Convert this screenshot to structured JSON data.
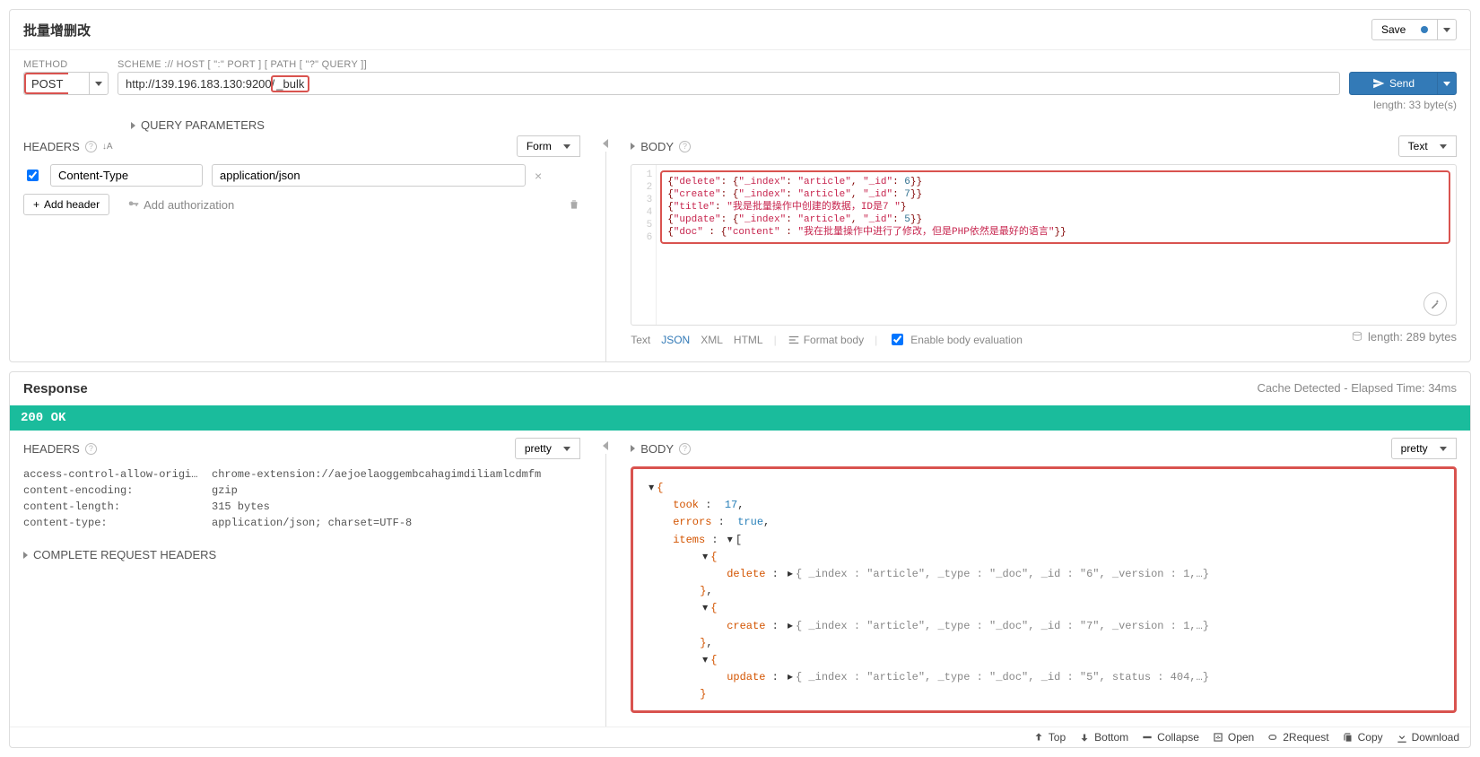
{
  "request": {
    "title": "批量增删改",
    "save_label": "Save",
    "method_label": "METHOD",
    "scheme_label": "SCHEME :// HOST [ \":\" PORT ] [ PATH [ \"?\" QUERY ]]",
    "method": "POST",
    "url_prefix": "http://139.196.183.130:9200/",
    "url_highlight": "_bulk",
    "send_label": "Send",
    "length_note": "length: 33 byte(s)",
    "query_params_label": "QUERY PARAMETERS",
    "headers_label": "HEADERS",
    "form_label": "Form",
    "header_name": "Content-Type",
    "header_value": "application/json",
    "add_header_label": "Add header",
    "add_auth_label": "Add authorization",
    "body_label": "BODY",
    "text_label": "Text",
    "body_lines": [
      "{\"delete\": {\"_index\": \"article\", \"_id\": 6}}",
      "{\"create\": {\"_index\": \"article\", \"_id\": 7}}",
      "{\"title\": \"我是批量操作中创建的数据，ID是7 \"}",
      "{\"update\": {\"_index\": \"article\", \"_id\": 5}}",
      "{\"doc\" : {\"content\" : \"我在批量操作中进行了修改，但是PHP依然是最好的语言\"}}"
    ],
    "footer_tabs": {
      "text": "Text",
      "json": "JSON",
      "xml": "XML",
      "html": "HTML"
    },
    "format_body_label": "Format body",
    "enable_eval_label": "Enable body evaluation",
    "body_length_label": "length: 289 bytes"
  },
  "response": {
    "title": "Response",
    "meta": "Cache Detected - Elapsed Time: 34ms",
    "status": "200  OK",
    "headers_label": "HEADERS",
    "pretty_label": "pretty",
    "headers": [
      {
        "k": "access-control-allow-origi…",
        "v": "chrome-extension://aejoelaoggembcahagimdiliamlcdmfm"
      },
      {
        "k": "content-encoding:",
        "v": "gzip"
      },
      {
        "k": "content-length:",
        "v": "315 bytes"
      },
      {
        "k": "content-type:",
        "v": "application/json; charset=UTF-8"
      }
    ],
    "complete_headers_label": "COMPLETE REQUEST HEADERS",
    "body_label": "BODY",
    "json": {
      "took_k": "took",
      "took_v": "17",
      "errors_k": "errors",
      "errors_v": "true",
      "items_k": "items",
      "rows": [
        {
          "op": "delete",
          "summary": "{ _index : \"article\",  _type : \"_doc\",  _id : \"6\",  _version : 1,…}"
        },
        {
          "op": "create",
          "summary": "{ _index : \"article\",  _type : \"_doc\",  _id : \"7\",  _version : 1,…}"
        },
        {
          "op": "update",
          "summary": "{ _index : \"article\",  _type : \"_doc\",  _id : \"5\",  status : 404,…}"
        }
      ]
    },
    "footer": {
      "top": "Top",
      "bottom": "Bottom",
      "collapse": "Collapse",
      "open": "Open",
      "tworeq": "2Request",
      "copy": "Copy",
      "download": "Download"
    }
  }
}
